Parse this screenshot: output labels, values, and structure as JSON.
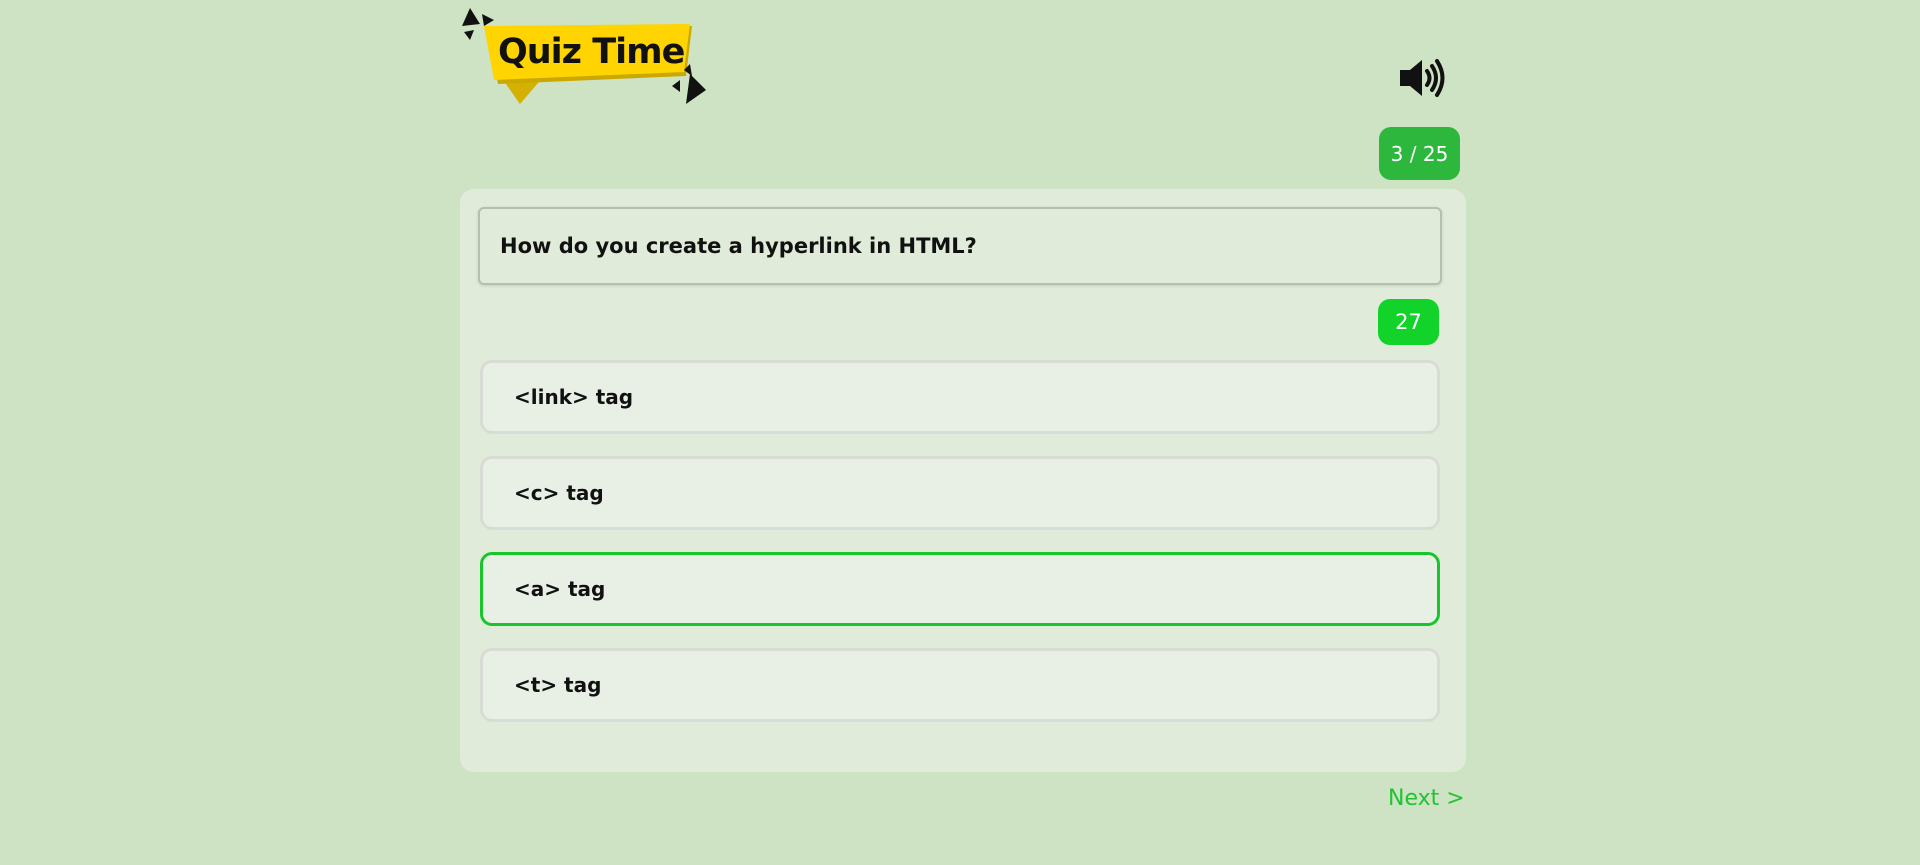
{
  "header": {
    "logo_text": "Quiz Time",
    "logo_icon": "quiz-time-banner",
    "sound_icon": "speaker-volume-icon"
  },
  "progress": {
    "label": "3 / 25",
    "current": 3,
    "total": 25
  },
  "question": {
    "text": "How do you create a hyperlink in HTML?"
  },
  "timer": {
    "value": "27"
  },
  "options": [
    {
      "label": "<link> tag",
      "selected": false
    },
    {
      "label": "<c> tag",
      "selected": false
    },
    {
      "label": "<a> tag",
      "selected": true
    },
    {
      "label": "<t> tag",
      "selected": false
    }
  ],
  "footer": {
    "next_label": "Next >"
  },
  "colors": {
    "background": "#cee3c4",
    "card": "#e0ecd9",
    "accent_green": "#2db83d",
    "timer_green": "#12d32a",
    "selected_border": "#18c62b",
    "logo_yellow": "#ffd400"
  }
}
